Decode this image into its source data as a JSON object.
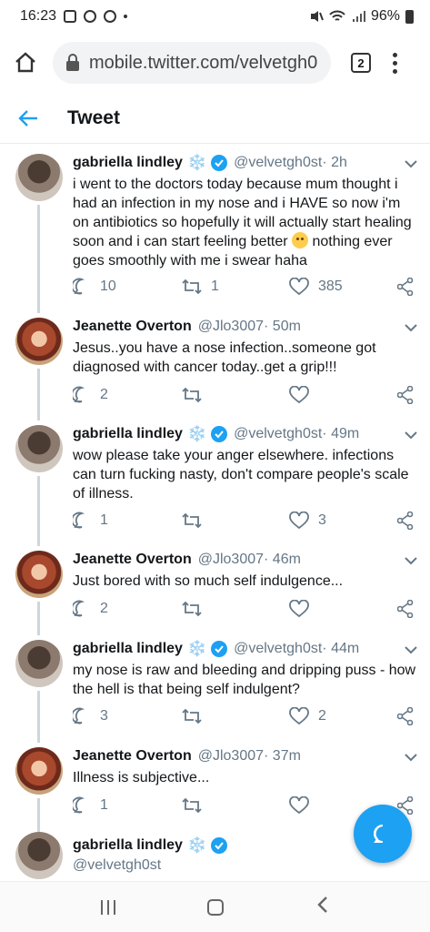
{
  "status_bar": {
    "time": "16:23",
    "battery": "96%",
    "icons": [
      "gallery-icon",
      "instagram-icon",
      "whatsapp-icon",
      "mute-icon",
      "wifi-icon",
      "signal-icon",
      "battery-icon"
    ]
  },
  "browser": {
    "url": "mobile.twitter.com/velvetgh0",
    "tab_count": "2"
  },
  "header": {
    "title": "Tweet"
  },
  "colors": {
    "accent": "#1da1f2",
    "secondary_text": "#657786",
    "flake": "#7aa7d6"
  },
  "tweets": [
    {
      "name": "gabriella lindley",
      "snowflake": "❄️",
      "verified": true,
      "handle": "@velvetgh0st",
      "time": "· 2h",
      "text": "i went to the doctors today because mum thought i had an infection in my nose and i HAVE so now i'm on antibiotics so hopefully it will actually start healing soon and i can start feeling better",
      "text_after_emoji": " nothing ever goes smoothly with me i swear haha",
      "replies": "10",
      "retweets": "1",
      "likes": "385"
    },
    {
      "name": "Jeanette Overton",
      "handle": "@Jlo3007",
      "time": "· 50m",
      "text": "Jesus..you have a nose infection..someone got diagnosed with cancer today..get a grip!!!",
      "replies": "2",
      "retweets": "",
      "likes": ""
    },
    {
      "name": "gabriella lindley",
      "snowflake": "❄️",
      "verified": true,
      "handle": "@velvetgh0st",
      "time": "· 49m",
      "text": "wow please take your anger elsewhere. infections can turn fucking nasty, don't compare people's scale of illness.",
      "replies": "1",
      "retweets": "",
      "likes": "3"
    },
    {
      "name": "Jeanette Overton",
      "handle": "@Jlo3007",
      "time": "· 46m",
      "text": "Just bored with so much self indulgence...",
      "replies": "2",
      "retweets": "",
      "likes": ""
    },
    {
      "name": "gabriella lindley",
      "snowflake": "❄️",
      "verified": true,
      "handle": "@velvetgh0st",
      "time": "· 44m",
      "text": "my nose is raw and bleeding and dripping puss - how the hell is that being self indulgent?",
      "replies": "3",
      "retweets": "",
      "likes": "2"
    },
    {
      "name": "Jeanette Overton",
      "handle": "@Jlo3007",
      "time": "· 37m",
      "text": "Illness is subjective...",
      "replies": "1",
      "retweets": "",
      "likes": ""
    },
    {
      "name": "gabriella lindley",
      "snowflake": "❄️",
      "verified": true,
      "handle": "@velvetgh0st"
    }
  ]
}
